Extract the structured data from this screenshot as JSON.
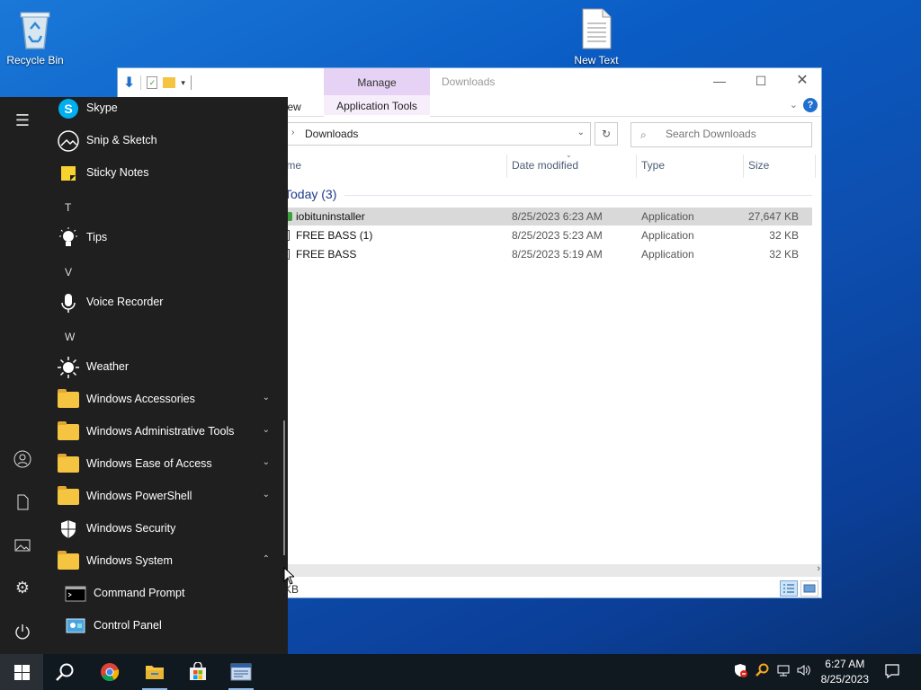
{
  "desktop": {
    "icons": [
      {
        "label": "Recycle Bin"
      },
      {
        "label": "New Text"
      }
    ]
  },
  "explorer": {
    "title": "Downloads",
    "manage_tab": "Manage",
    "ribbon_tabs": {
      "view": "View",
      "app_tools": "Application Tools"
    },
    "address": "Downloads",
    "search_placeholder": "Search Downloads",
    "columns": {
      "name": "Name",
      "date": "Date modified",
      "type": "Type",
      "size": "Size"
    },
    "group": "Today (3)",
    "files": [
      {
        "name": "iobituninstaller",
        "date": "8/25/2023 6:23 AM",
        "type": "Application",
        "size": "27,647 KB",
        "selected": true
      },
      {
        "name": "FREE BASS (1)",
        "date": "8/25/2023 5:23 AM",
        "type": "Application",
        "size": "32 KB",
        "selected": false
      },
      {
        "name": "FREE BASS",
        "date": "8/25/2023 5:19 AM",
        "type": "Application",
        "size": "32 KB",
        "selected": false
      }
    ],
    "status": "KB"
  },
  "start_menu": {
    "letters": {
      "t": "T",
      "v": "V",
      "w": "W"
    },
    "apps": [
      {
        "label": "Skype"
      },
      {
        "label": "Snip & Sketch"
      },
      {
        "label": "Sticky Notes"
      },
      {
        "label": "Tips"
      },
      {
        "label": "Voice Recorder"
      },
      {
        "label": "Weather"
      },
      {
        "label": "Windows Accessories"
      },
      {
        "label": "Windows Administrative Tools"
      },
      {
        "label": "Windows Ease of Access"
      },
      {
        "label": "Windows PowerShell"
      },
      {
        "label": "Windows Security"
      },
      {
        "label": "Windows System"
      },
      {
        "label": "Command Prompt"
      },
      {
        "label": "Control Panel"
      }
    ]
  },
  "taskbar": {
    "time": "6:27 AM",
    "date": "8/25/2023"
  },
  "colors": {
    "accent": "#0078d7",
    "manage_tab": "#e6d2f4",
    "start_bg": "#1f1f1f",
    "taskbar_bg": "#101820",
    "folder": "#f5c542"
  }
}
